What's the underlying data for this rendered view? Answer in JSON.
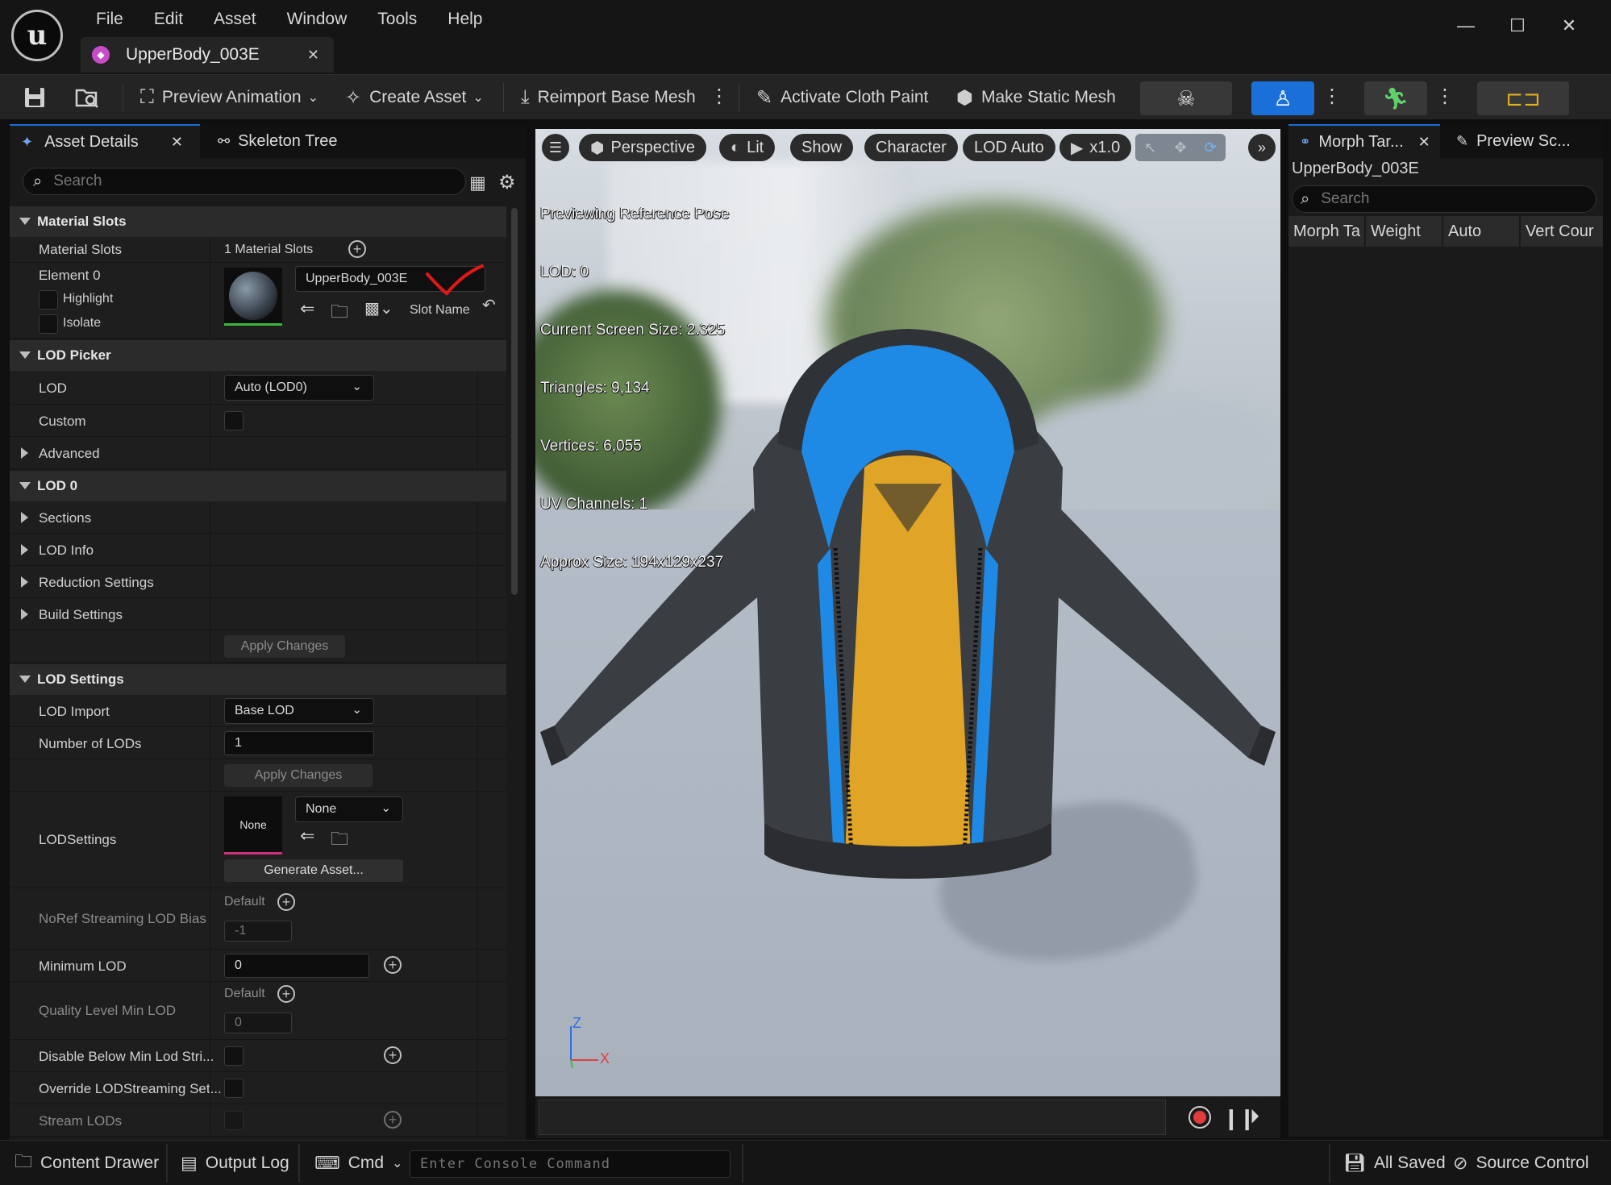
{
  "app": {
    "logo_text": "u",
    "menu": [
      "File",
      "Edit",
      "Asset",
      "Window",
      "Tools",
      "Help"
    ],
    "doc_tab": "UpperBody_003E",
    "win_minimize": "—",
    "win_maximize": "☐",
    "win_close": "✕"
  },
  "toolbar": {
    "preview_animation": "Preview Animation",
    "create_asset": "Create Asset",
    "reimport": "Reimport Base Mesh",
    "cloth_paint": "Activate Cloth Paint",
    "static_mesh": "Make Static Mesh",
    "active_mode": "mesh-mode"
  },
  "left_panel": {
    "tab_details": "Asset Details",
    "tab_skeleton": "Skeleton Tree",
    "search_placeholder": "Search",
    "material_slots": {
      "header": "Material Slots",
      "label": "Material Slots",
      "count": "1 Material Slots",
      "element": "Element 0",
      "highlight": "Highlight",
      "isolate": "Isolate",
      "slot_value": "UpperBody_003E",
      "slot_name": "Slot Name"
    },
    "lod_picker": {
      "header": "LOD Picker",
      "lod_label": "LOD",
      "lod_value": "Auto (LOD0)",
      "custom": "Custom",
      "advanced": "Advanced"
    },
    "lod0": {
      "header": "LOD 0",
      "sections": "Sections",
      "lod_info": "LOD Info",
      "reduction": "Reduction Settings",
      "build": "Build Settings",
      "apply": "Apply Changes"
    },
    "lod_settings": {
      "header": "LOD Settings",
      "lod_import": "LOD Import",
      "lod_import_value": "Base LOD",
      "num_lods": "Number of LODs",
      "num_lods_value": "1",
      "apply": "Apply Changes",
      "lodsettings": "LODSettings",
      "thumb_none": "None",
      "asset_value": "None",
      "generate": "Generate Asset...",
      "noref_label": "NoRef Streaming LOD Bias",
      "noref_default": "Default",
      "noref_value": "-1",
      "min_lod": "Minimum LOD",
      "min_lod_value": "0",
      "quality_min": "Quality Level Min LOD",
      "quality_default": "Default",
      "quality_value": "0",
      "disable_below": "Disable Below Min Lod Stri...",
      "override_streaming": "Override LODStreaming Set...",
      "stream_lods": "Stream LODs"
    }
  },
  "viewport": {
    "perspective": "Perspective",
    "lit": "Lit",
    "show": "Show",
    "character": "Character",
    "lod_auto": "LOD Auto",
    "speed": "x1.0",
    "stats": [
      "Previewing Reference Pose",
      "LOD: 0",
      "Current Screen Size: 2.325",
      "Triangles: 9,134",
      "Vertices: 6,055",
      "UV Channels: 1",
      "Approx Size: 194x129x237"
    ],
    "axis_z": "Z",
    "axis_x": "X"
  },
  "right_panel": {
    "tab_morph": "Morph Tar...",
    "tab_preview": "Preview Sc...",
    "title": "UpperBody_003E",
    "search_placeholder": "Search",
    "columns": [
      "Morph Ta",
      "Weight",
      "Auto",
      "Vert Cour"
    ]
  },
  "statusbar": {
    "content_drawer": "Content Drawer",
    "output_log": "Output Log",
    "cmd": "Cmd",
    "console_placeholder": "Enter Console Command",
    "all_saved": "All Saved",
    "source_control": "Source Control"
  },
  "colors": {
    "accent": "#1a6fd8",
    "check_mark": "#e01818",
    "jacket_blue": "#1e8ae6",
    "jacket_yellow": "#e0a526",
    "jacket_dark": "#3a3d42",
    "record": "#e23b3b"
  }
}
